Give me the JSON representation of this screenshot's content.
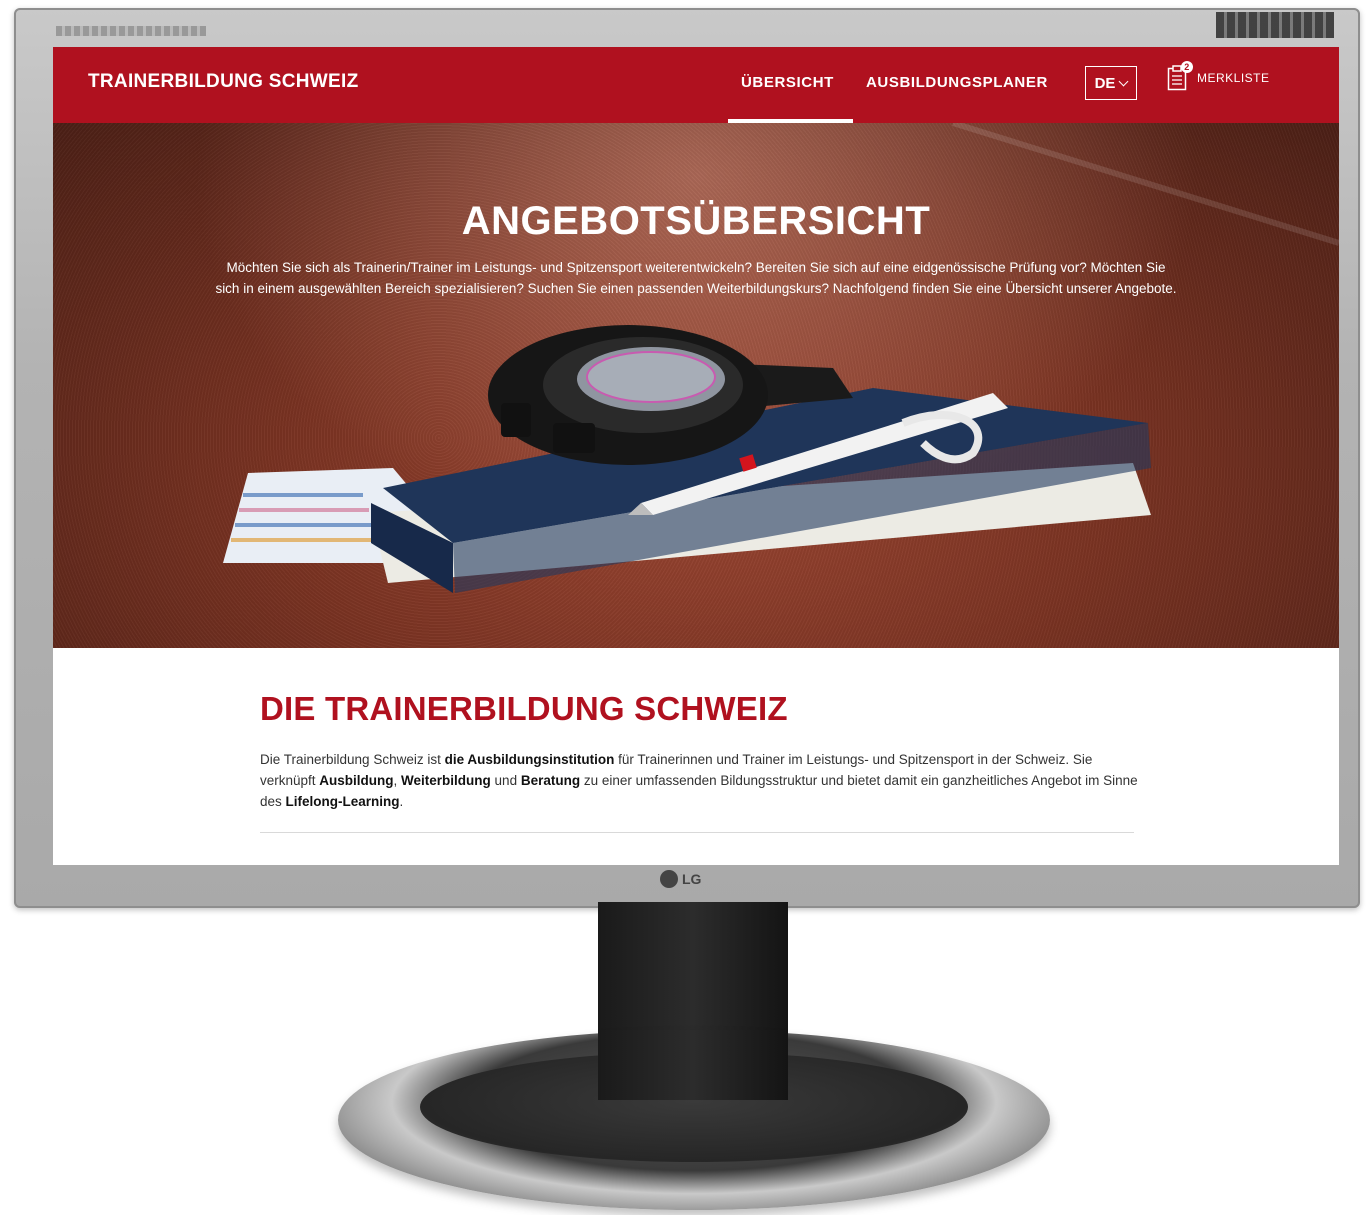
{
  "nav": {
    "brand": "TRAINERBILDUNG SCHWEIZ",
    "links": [
      {
        "label": "ÜBERSICHT",
        "active": true
      },
      {
        "label": "AUSBILDUNGSPLANER",
        "active": false
      }
    ],
    "language": "DE",
    "merkliste": {
      "label": "MERKLISTE",
      "count": "2"
    }
  },
  "hero": {
    "title": "ANGEBOTSÜBERSICHT",
    "text": "Möchten Sie sich als Trainerin/Trainer im Leistungs- und Spitzensport weiterentwickeln? Bereiten Sie sich auf eine eidgenössische Prüfung vor? Möchten Sie sich in einem ausgewählten Bereich spezialisieren? Suchen Sie einen passenden Weiterbildungskurs? Nachfolgend finden Sie eine Übersicht unserer Angebote."
  },
  "content": {
    "heading": "DIE TRAINERBILDUNG SCHWEIZ",
    "paragraph": [
      {
        "text": "Die Trainerbildung Schweiz ist ",
        "bold": false
      },
      {
        "text": "die Ausbildungsinstitution",
        "bold": true
      },
      {
        "text": " für Trainerinnen und Trainer im Leistungs- und Spitzensport in der Schweiz. Sie verknüpft ",
        "bold": false
      },
      {
        "text": "Ausbildung",
        "bold": true
      },
      {
        "text": ", ",
        "bold": false
      },
      {
        "text": "Weiterbildung",
        "bold": true
      },
      {
        "text": " und ",
        "bold": false
      },
      {
        "text": "Beratung",
        "bold": true
      },
      {
        "text": " zu einer umfassenden Bildungsstruktur und bietet damit ein ganzheitliches Angebot im Sinne des ",
        "bold": false
      },
      {
        "text": "Lifelong-Learning",
        "bold": true
      },
      {
        "text": ".",
        "bold": false
      }
    ]
  },
  "monitor": {
    "brand": "LG"
  },
  "colors": {
    "primary": "#b0111f",
    "text": "#333333",
    "white": "#ffffff"
  }
}
